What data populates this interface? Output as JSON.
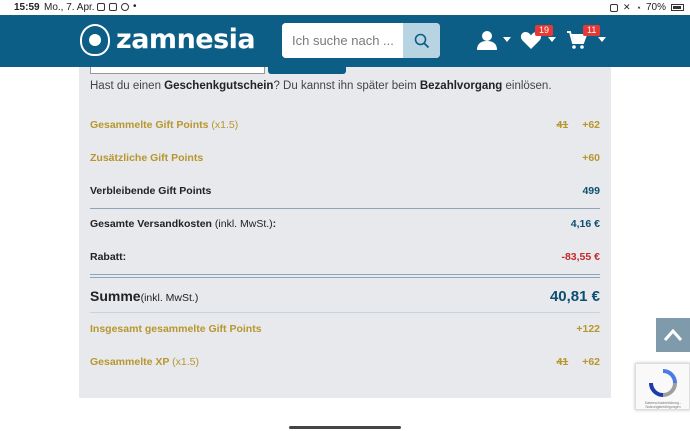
{
  "statusbar": {
    "time": "15:59",
    "date": "Mo., 7. Apr.",
    "battery": "70%"
  },
  "header": {
    "logo_text": "zamnesia",
    "search_placeholder": "Ich suche nach ...",
    "wishlist_count": "19",
    "cart_count": "11",
    "brand_color": "#0d5e86"
  },
  "gift_note": {
    "prefix": "Hast du einen ",
    "voucher": "Geschenkgutschein",
    "middle": "? Du kannst ihn später beim ",
    "checkout": "Bezahlvorgang",
    "suffix": " einlösen."
  },
  "summary": {
    "collected_points": {
      "label": "Gesammelte Gift Points",
      "sub": "(x1.5)",
      "old": "41",
      "value": "+62"
    },
    "additional_points": {
      "label": "Zusätzliche Gift Points",
      "value": "+60"
    },
    "remaining_points": {
      "label": "Verbleibende Gift Points",
      "value": "499"
    },
    "shipping": {
      "label": "Gesamte Versandkosten",
      "sub": "(inkl. MwSt.)",
      "colon": ":",
      "value": "4,16 €"
    },
    "discount": {
      "label": "Rabatt:",
      "value": "-83,55 €"
    },
    "total": {
      "label": "Summe",
      "sub": "(inkl. MwSt.)",
      "value": "40,81 €"
    },
    "total_points": {
      "label": "Insgesamt gesammelte Gift Points",
      "value": "+122"
    },
    "xp": {
      "label": "Gesammelte XP",
      "sub": "(x1.5)",
      "old": "41",
      "value": "+62"
    }
  },
  "recaptcha": {
    "text": "Datenschutzerklärung - Nutzungsbedingungen"
  },
  "icons": [
    "search-icon",
    "user-icon",
    "heart-icon",
    "cart-icon",
    "chevron-up-icon",
    "recaptcha-icon"
  ]
}
